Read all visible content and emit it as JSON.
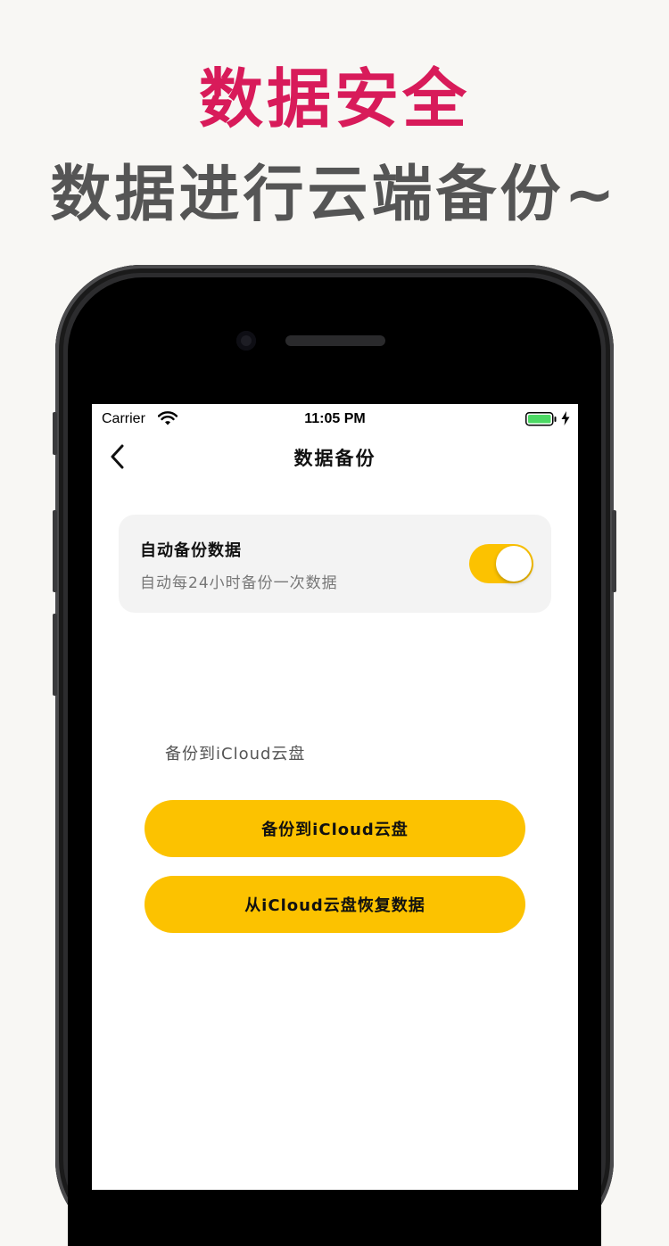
{
  "promo": {
    "title": "数据安全",
    "subtitle": "数据进行云端备份~",
    "title_color": "#d81b5a",
    "subtitle_color": "#555555"
  },
  "status_bar": {
    "carrier": "Carrier",
    "time": "11:05 PM",
    "icons": [
      "wifi-icon",
      "battery-icon",
      "charging-bolt-icon"
    ]
  },
  "nav": {
    "title": "数据备份",
    "back_icon": "chevron-left-icon"
  },
  "auto_backup": {
    "title": "自动备份数据",
    "subtitle": "自动每24小时备份一次数据",
    "enabled": true
  },
  "icloud": {
    "section_label": "备份到iCloud云盘",
    "backup_button": "备份到iCloud云盘",
    "restore_button": "从iCloud云盘恢复数据"
  },
  "colors": {
    "accent": "#fcc200",
    "battery": "#4cd964"
  }
}
